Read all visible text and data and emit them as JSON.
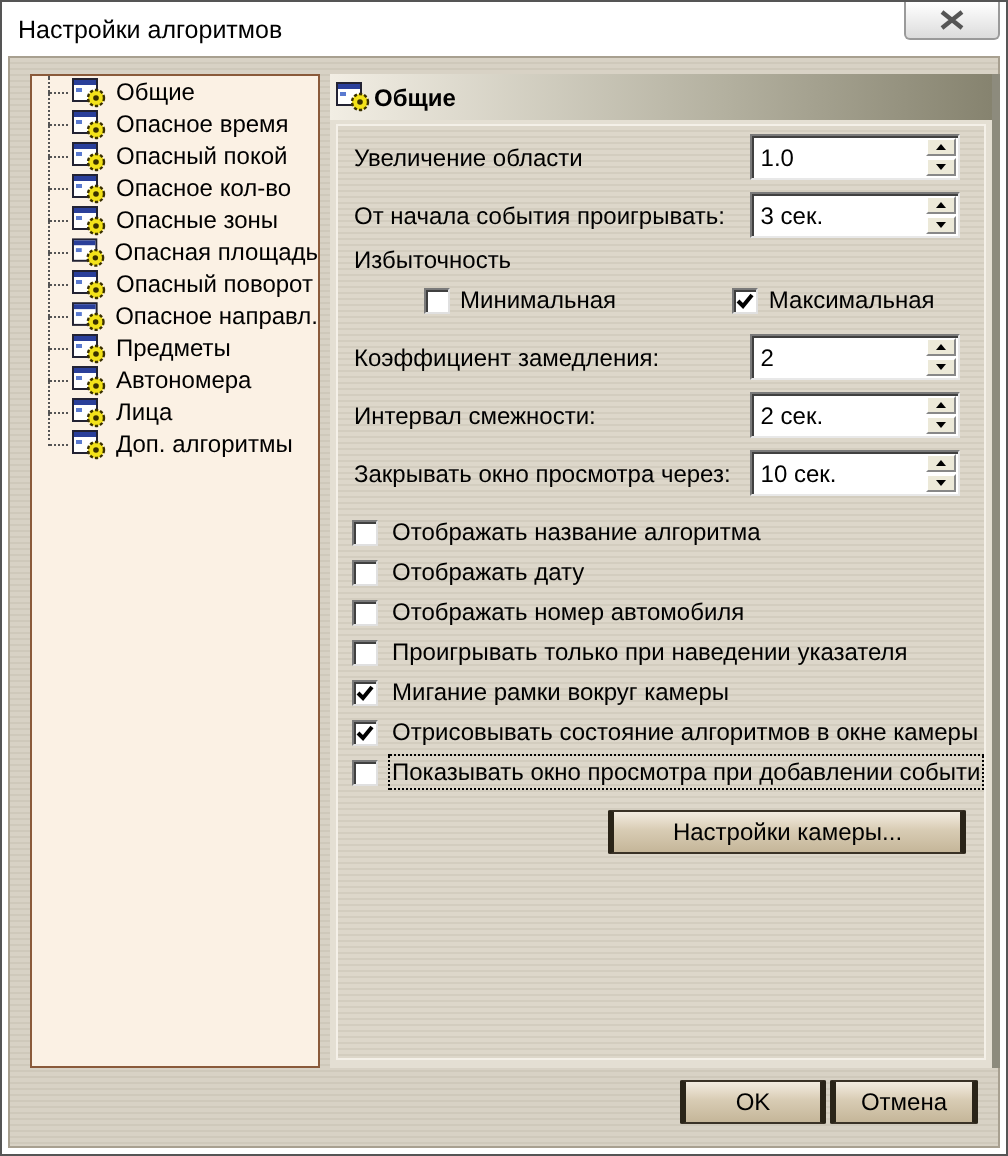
{
  "window": {
    "title": "Настройки алгоритмов"
  },
  "tree": {
    "items": [
      {
        "label": "Общие"
      },
      {
        "label": "Опасное время"
      },
      {
        "label": "Опасный покой"
      },
      {
        "label": "Опасное кол-во"
      },
      {
        "label": "Опасные зоны"
      },
      {
        "label": "Опасная площадь"
      },
      {
        "label": "Опасный поворот"
      },
      {
        "label": "Опасное направл."
      },
      {
        "label": "Предметы"
      },
      {
        "label": "Автономера"
      },
      {
        "label": "Лица"
      },
      {
        "label": "Доп. алгоритмы"
      }
    ]
  },
  "panel": {
    "title": "Общие",
    "fields_top": [
      {
        "label": "Увеличение области",
        "value": "1.0"
      },
      {
        "label": "От начала события проигрывать:",
        "value": "3 сек."
      }
    ],
    "redundancy": {
      "label": "Избыточность",
      "options": [
        {
          "label": "Минимальная",
          "checked": false
        },
        {
          "label": "Максимальная",
          "checked": true
        }
      ]
    },
    "fields_bottom": [
      {
        "label": "Коэффициент замедления:",
        "value": "2"
      },
      {
        "label": "Интервал смежности:",
        "value": "2 сек."
      },
      {
        "label": "Закрывать окно просмотра через:",
        "value": "10 сек."
      }
    ],
    "checkboxes": [
      {
        "label": "Отображать название алгоритма",
        "checked": false,
        "focused": false
      },
      {
        "label": "Отображать дату",
        "checked": false,
        "focused": false
      },
      {
        "label": "Отображать номер автомобиля",
        "checked": false,
        "focused": false
      },
      {
        "label": "Проигрывать только при наведении указателя",
        "checked": false,
        "focused": false
      },
      {
        "label": "Мигание рамки вокруг камеры",
        "checked": true,
        "focused": false
      },
      {
        "label": "Отрисовывать состояние алгоритмов в окне камеры",
        "checked": true,
        "focused": false
      },
      {
        "label": "Показывать окно просмотра при добавлении событи",
        "checked": false,
        "focused": true
      }
    ],
    "camera_button": "Настройки камеры..."
  },
  "buttons": [
    "OK",
    "Отмена"
  ]
}
